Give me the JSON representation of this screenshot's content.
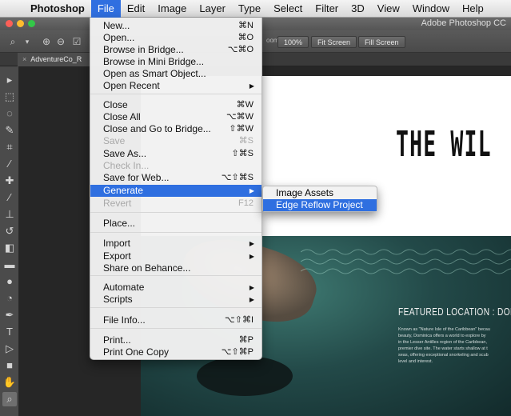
{
  "menubar": {
    "apple_icon": "apple-icon",
    "items": [
      "Photoshop",
      "File",
      "Edit",
      "Image",
      "Layer",
      "Type",
      "Select",
      "Filter",
      "3D",
      "View",
      "Window",
      "Help"
    ],
    "active": "File"
  },
  "titlebar": {
    "app_title": "Adobe Photoshop CC",
    "lights": [
      "#fc5f57",
      "#fdbc2e",
      "#33c748"
    ]
  },
  "options_bar": {
    "zoom_label": "oom",
    "buttons": [
      "100%",
      "Fit Screen",
      "Fill Screen"
    ]
  },
  "document": {
    "tab_label": "AdventureCo_R",
    "tab_close": "×",
    "headline": "THE WIL",
    "featured": "FEATURED LOCATION : DOMINI",
    "body_lines": [
      "Known as \"Nature Isle of the Caribbean\" becau",
      "beauty, Dominica offers a world to explore by",
      "in the Lesser Antilles region of the Caribbean,",
      "premier dive site. The water starts shallow at t",
      "seas, offering exceptional snorkeling and scub",
      "level and interest."
    ]
  },
  "file_menu": {
    "items": [
      {
        "label": "New...",
        "shortcut": "⌘N"
      },
      {
        "label": "Open...",
        "shortcut": "⌘O"
      },
      {
        "label": "Browse in Bridge...",
        "shortcut": "⌥⌘O"
      },
      {
        "label": "Browse in Mini Bridge...",
        "shortcut": ""
      },
      {
        "label": "Open as Smart Object...",
        "shortcut": ""
      },
      {
        "label": "Open Recent",
        "shortcut": "",
        "submenu": true
      },
      {
        "label": "Close",
        "shortcut": "⌘W"
      },
      {
        "label": "Close All",
        "shortcut": "⌥⌘W"
      },
      {
        "label": "Close and Go to Bridge...",
        "shortcut": "⇧⌘W"
      },
      {
        "label": "Save",
        "shortcut": "⌘S",
        "disabled": true
      },
      {
        "label": "Save As...",
        "shortcut": "⇧⌘S"
      },
      {
        "label": "Check In...",
        "shortcut": "",
        "disabled": true
      },
      {
        "label": "Save for Web...",
        "shortcut": "⌥⇧⌘S"
      },
      {
        "label": "Generate",
        "shortcut": "",
        "submenu": true,
        "highlighted": true
      },
      {
        "label": "Revert",
        "shortcut": "F12",
        "disabled": true
      },
      {
        "label": "Place...",
        "shortcut": ""
      },
      {
        "label": "Import",
        "shortcut": "",
        "submenu": true
      },
      {
        "label": "Export",
        "shortcut": "",
        "submenu": true
      },
      {
        "label": "Share on Behance...",
        "shortcut": ""
      },
      {
        "label": "Automate",
        "shortcut": "",
        "submenu": true
      },
      {
        "label": "Scripts",
        "shortcut": "",
        "submenu": true
      },
      {
        "label": "File Info...",
        "shortcut": "⌥⇧⌘I"
      },
      {
        "label": "Print...",
        "shortcut": "⌘P"
      },
      {
        "label": "Print One Copy",
        "shortcut": "⌥⇧⌘P"
      }
    ],
    "submenu_arrow": "▶"
  },
  "generate_submenu": {
    "items": [
      {
        "label": "Image Assets",
        "highlighted": false
      },
      {
        "label": "Edge Reflow Project",
        "highlighted": true
      }
    ]
  },
  "toolbox": {
    "tools": [
      {
        "name": "move-tool-icon",
        "glyph": "▸"
      },
      {
        "name": "marquee-tool-icon",
        "glyph": "⬚"
      },
      {
        "name": "lasso-tool-icon",
        "glyph": "◌"
      },
      {
        "name": "quick-select-tool-icon",
        "glyph": "✎"
      },
      {
        "name": "crop-tool-icon",
        "glyph": "⌗"
      },
      {
        "name": "eyedropper-tool-icon",
        "glyph": "⁄"
      },
      {
        "name": "healing-brush-tool-icon",
        "glyph": "✚"
      },
      {
        "name": "brush-tool-icon",
        "glyph": "∕"
      },
      {
        "name": "clone-stamp-tool-icon",
        "glyph": "⊥"
      },
      {
        "name": "history-brush-tool-icon",
        "glyph": "↺"
      },
      {
        "name": "eraser-tool-icon",
        "glyph": "◧"
      },
      {
        "name": "gradient-tool-icon",
        "glyph": "▬"
      },
      {
        "name": "blur-tool-icon",
        "glyph": "●"
      },
      {
        "name": "dodge-tool-icon",
        "glyph": "◔"
      },
      {
        "name": "pen-tool-icon",
        "glyph": "✒"
      },
      {
        "name": "type-tool-icon",
        "glyph": "T"
      },
      {
        "name": "path-select-tool-icon",
        "glyph": "▷"
      },
      {
        "name": "rectangle-tool-icon",
        "glyph": "■"
      },
      {
        "name": "hand-tool-icon",
        "glyph": "✋"
      },
      {
        "name": "zoom-tool-icon",
        "glyph": "⌕"
      }
    ]
  }
}
